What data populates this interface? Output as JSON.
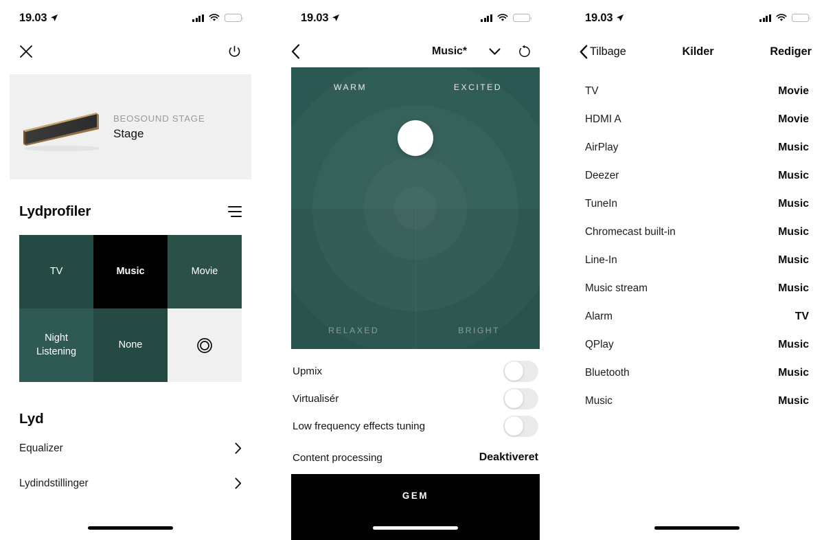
{
  "statusbar": {
    "time": "19.03",
    "location_icon": "location-arrow-icon",
    "signal_icon": "cellular-bars-icon",
    "wifi_icon": "wifi-icon",
    "battery_icon": "battery-low-icon"
  },
  "colors": {
    "tile_dark_green": "#254a43",
    "tile_green": "#2b5048",
    "tile_light_teal": "#2f5a53",
    "tile_selected_black": "#000000",
    "tile_empty_gray": "#f0f0f0",
    "wheel_green": "#2a5650",
    "battery_yellow": "#f3c23c",
    "card_gray": "#f0f0f0"
  },
  "panel1": {
    "nav": {
      "close_icon": "close-icon",
      "power_icon": "power-icon"
    },
    "device": {
      "model": "BEOSOUND STAGE",
      "name": "Stage",
      "image": "soundbar-image"
    },
    "sound_profiles": {
      "title": "Lydprofiler",
      "menu_icon": "hamburger-icon",
      "tiles": [
        {
          "label": "TV",
          "color": "#254a43",
          "selected": false,
          "icon": null
        },
        {
          "label": "Music",
          "color": "#000000",
          "selected": true,
          "icon": null
        },
        {
          "label": "Movie",
          "color": "#2b5048",
          "selected": false,
          "icon": null
        },
        {
          "label": "Night Listening",
          "color": "#2f5a53",
          "selected": false,
          "icon": null
        },
        {
          "label": "None",
          "color": "#254a43",
          "selected": false,
          "icon": null
        },
        {
          "label": "",
          "color": "#f0f0f0",
          "selected": false,
          "icon": "target-rings-icon"
        }
      ]
    },
    "sound": {
      "title": "Lyd",
      "rows": [
        {
          "label": "Equalizer",
          "chevron": "chevron-right-icon"
        },
        {
          "label": "Lydindstillinger",
          "chevron": "chevron-right-icon"
        }
      ]
    }
  },
  "panel2": {
    "nav": {
      "back_icon": "chevron-left-icon",
      "title": "Music*",
      "dropdown_icon": "chevron-down-icon",
      "reset_icon": "reset-circular-arrow-icon"
    },
    "wheel": {
      "label_top_left": "WARM",
      "label_top_right": "EXCITED",
      "label_bottom_left": "RELAXED",
      "label_bottom_right": "BRIGHT",
      "handle_name": "sound-wheel-handle"
    },
    "toggles": [
      {
        "label": "Upmix",
        "on": false
      },
      {
        "label": "Virtualisér",
        "on": false
      },
      {
        "label": "Low frequency effects tuning",
        "on": false
      }
    ],
    "content_processing": {
      "label": "Content processing",
      "value": "Deaktiveret"
    },
    "save_label": "GEM"
  },
  "panel3": {
    "nav": {
      "back_icon": "chevron-left-icon",
      "back_label": "Tilbage",
      "title": "Kilder",
      "edit_label": "Rediger"
    },
    "sources": [
      {
        "name": "TV",
        "profile": "Movie"
      },
      {
        "name": "HDMI A",
        "profile": "Movie"
      },
      {
        "name": "AirPlay",
        "profile": "Music"
      },
      {
        "name": "Deezer",
        "profile": "Music"
      },
      {
        "name": "TuneIn",
        "profile": "Music"
      },
      {
        "name": "Chromecast built-in",
        "profile": "Music"
      },
      {
        "name": "Line-In",
        "profile": "Music"
      },
      {
        "name": "Music stream",
        "profile": "Music"
      },
      {
        "name": "Alarm",
        "profile": "TV"
      },
      {
        "name": "QPlay",
        "profile": "Music"
      },
      {
        "name": "Bluetooth",
        "profile": "Music"
      },
      {
        "name": "Music",
        "profile": "Music"
      }
    ]
  }
}
